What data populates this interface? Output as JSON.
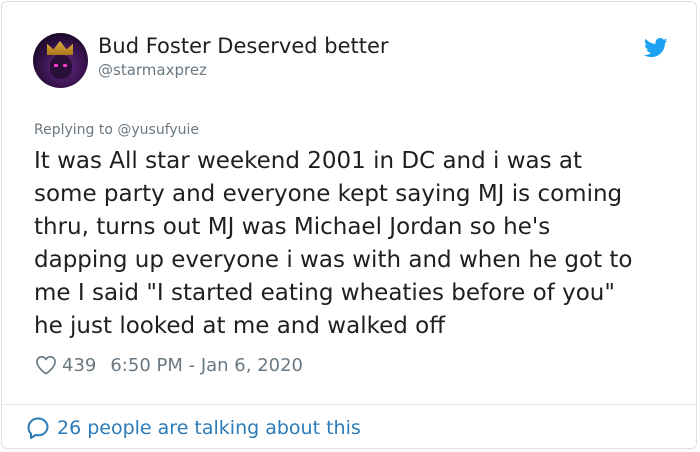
{
  "tweet": {
    "display_name": "Bud Foster Deserved better",
    "handle": "@starmaxprez",
    "replying_to": "Replying to @yusufyuie",
    "text_lines": [
      "It was All star weekend 2001 in DC and i was at",
      "some party and everyone kept saying MJ is coming",
      "thru, turns out MJ was Michael Jordan so he's",
      "dapping up everyone i was with and when he got to",
      "me I said \"I started eating wheaties before of you\"",
      "he just looked at me and walked off"
    ],
    "likes": "439",
    "timestamp": "6:50 PM - Jan 6, 2020",
    "talking": "26 people are talking about this"
  },
  "icons": {
    "brand": "twitter-bird-icon",
    "like": "heart-icon",
    "conversation": "speech-bubble-icon"
  },
  "colors": {
    "brand_blue": "#1da1f2",
    "link_blue": "#2b7bb9",
    "text": "#1c2022",
    "muted": "#697882"
  }
}
